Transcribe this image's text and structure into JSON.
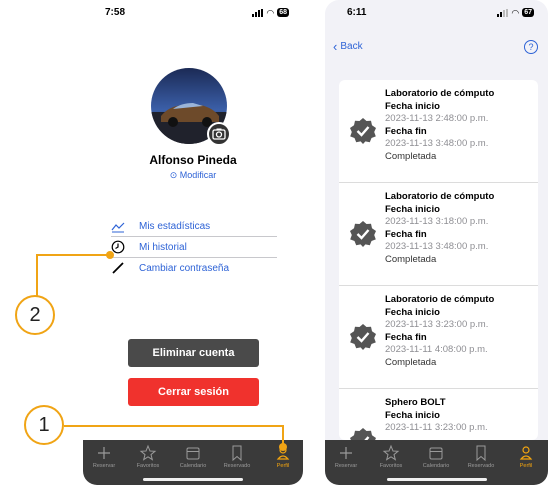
{
  "left_screen": {
    "status": {
      "time": "7:58",
      "battery": "68"
    },
    "profile": {
      "name": "Alfonso Pineda",
      "edit_label": "⊙ Modificar"
    },
    "menu": [
      {
        "label": "Mis estadísticas",
        "icon": "chart-line-icon"
      },
      {
        "label": "Mi historial",
        "icon": "clock-icon"
      },
      {
        "label": "Cambiar contraseña",
        "icon": "pencil-icon"
      }
    ],
    "buttons": {
      "delete_account": "Eliminar cuenta",
      "logout": "Cerrar sesión"
    }
  },
  "tabbar": {
    "tabs": [
      {
        "label": "Reservar",
        "icon": "plus-icon"
      },
      {
        "label": "Favoritos",
        "icon": "star-icon"
      },
      {
        "label": "Calendario",
        "icon": "calendar-icon"
      },
      {
        "label": "Reservado",
        "icon": "bookmark-icon"
      },
      {
        "label": "Perfil",
        "icon": "person-icon"
      }
    ],
    "active_tab": "Perfil"
  },
  "callouts": {
    "one": "1",
    "two": "2"
  },
  "right_screen": {
    "status": {
      "time": "6:11",
      "battery": "67"
    },
    "nav": {
      "back_label": "Back",
      "help_label": "?"
    },
    "history": [
      {
        "title": "Laboratorio de cómputo",
        "start_label": "Fecha inicio",
        "start": "2023-11-13 2:48:00 p.m.",
        "end_label": "Fecha fin",
        "end": "2023-11-13 3:48:00 p.m.",
        "status": "Completada"
      },
      {
        "title": "Laboratorio de cómputo",
        "start_label": "Fecha inicio",
        "start": "2023-11-13 3:18:00 p.m.",
        "end_label": "Fecha fin",
        "end": "2023-11-13 3:48:00 p.m.",
        "status": "Completada"
      },
      {
        "title": "Laboratorio de cómputo",
        "start_label": "Fecha inicio",
        "start": "2023-11-13 3:23:00 p.m.",
        "end_label": "Fecha fin",
        "end": "2023-11-11 4:08:00 p.m.",
        "status": "Completada"
      },
      {
        "title": "Sphero BOLT",
        "start_label": "Fecha inicio",
        "start": "2023-11-11 3:23:00 p.m."
      }
    ]
  },
  "colors": {
    "accent_blue": "#2e63d6",
    "callout_orange": "#f0a415",
    "tab_active": "#f3a50f",
    "logout_red": "#f0322d",
    "delete_gray": "#4a4a4a",
    "tabbar_bg": "#3a3a3a"
  }
}
